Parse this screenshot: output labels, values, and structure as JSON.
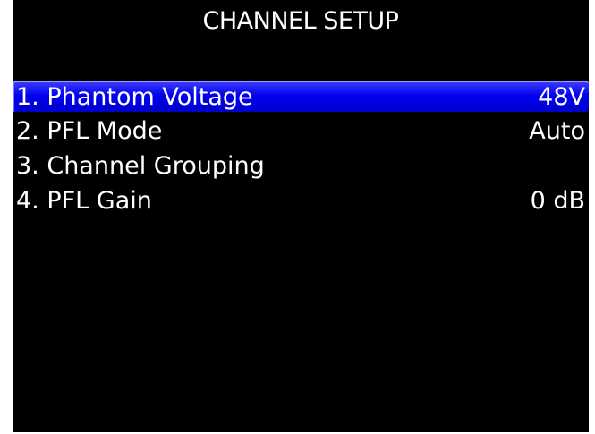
{
  "screen": {
    "title": "CHANNEL SETUP"
  },
  "menu": {
    "items": [
      {
        "label": "1. Phantom Voltage",
        "value": "48V",
        "selected": true
      },
      {
        "label": "2. PFL Mode",
        "value": "Auto",
        "selected": false
      },
      {
        "label": "3. Channel Grouping",
        "value": "",
        "selected": false
      },
      {
        "label": "4. PFL Gain",
        "value": "0 dB",
        "selected": false
      }
    ]
  },
  "colors": {
    "background": "#000000",
    "text": "#ffffff",
    "selection": "#0000ee"
  }
}
